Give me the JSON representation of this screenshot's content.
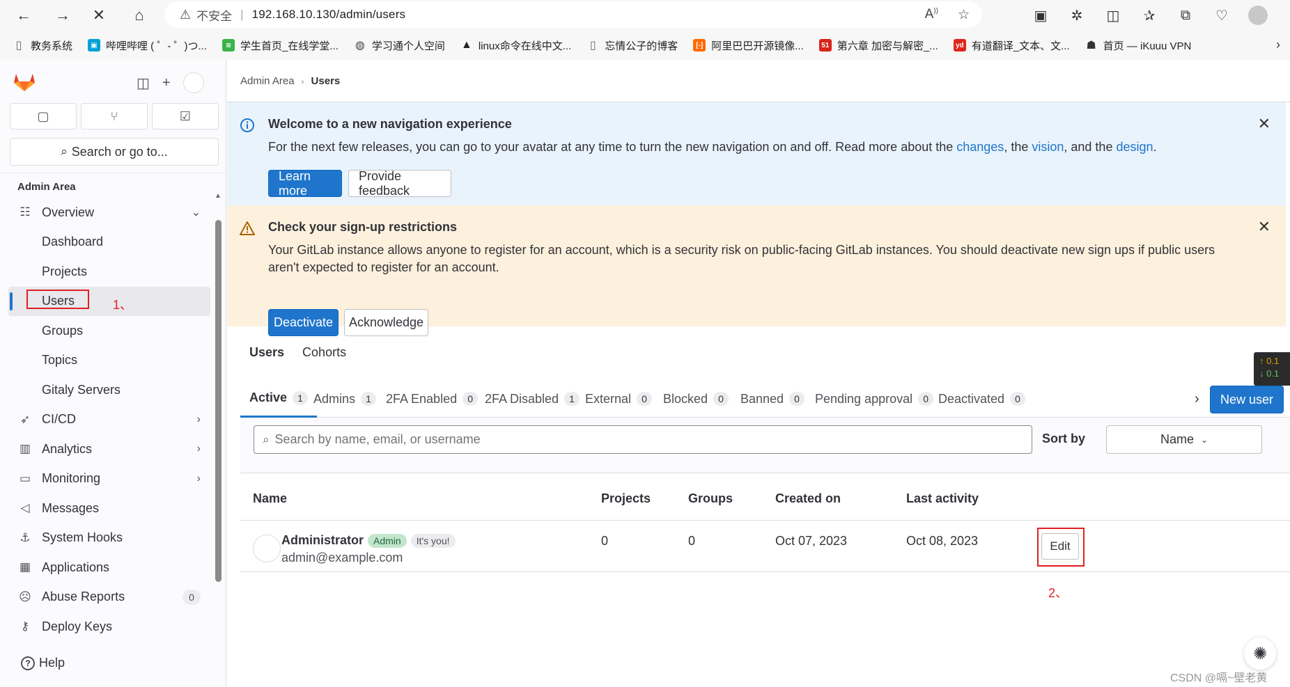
{
  "browser": {
    "insecure_label": "不安全",
    "url": "192.168.10.130/admin/users",
    "bookmarks": [
      {
        "label": "教务系统",
        "icon": "document-icon",
        "color": "#666666"
      },
      {
        "label": "哔哩哔哩 ( ゜- ゜)つ...",
        "icon": "bilibili-icon",
        "color": "#00a1d6"
      },
      {
        "label": "学生首页_在线学堂...",
        "icon": "xuetang-icon",
        "color": "#3bb34a"
      },
      {
        "label": "学习通个人空间",
        "icon": "globe-icon",
        "color": "#444444"
      },
      {
        "label": "linux命令在线中文...",
        "icon": "tux-icon",
        "color": "#222222"
      },
      {
        "label": "忘情公子的博客",
        "icon": "document-icon",
        "color": "#666666"
      },
      {
        "label": "阿里巴巴开源镜像...",
        "icon": "aliyun-icon",
        "color": "#ff6a00"
      },
      {
        "label": "第六章 加密与解密_...",
        "icon": "51cto-icon",
        "color": "#d9251c"
      },
      {
        "label": "有道翻译_文本、文...",
        "icon": "youdao-icon",
        "color": "#e1251b"
      },
      {
        "label": "首页 — iKuuu VPN",
        "icon": "ikuuu-icon",
        "color": "#333333"
      }
    ]
  },
  "sidebar": {
    "search_placeholder": "Search or go to...",
    "section_title": "Admin Area",
    "items": [
      {
        "label": "Overview",
        "icon": "overview-icon",
        "chevron": "down"
      },
      {
        "label": "Dashboard",
        "sub": true
      },
      {
        "label": "Projects",
        "sub": true
      },
      {
        "label": "Users",
        "sub": true,
        "active": true
      },
      {
        "label": "Groups",
        "sub": true
      },
      {
        "label": "Topics",
        "sub": true
      },
      {
        "label": "Gitaly Servers",
        "sub": true
      },
      {
        "label": "CI/CD",
        "icon": "rocket-icon",
        "chevron": "right"
      },
      {
        "label": "Analytics",
        "icon": "chart-icon",
        "chevron": "right"
      },
      {
        "label": "Monitoring",
        "icon": "monitor-icon",
        "chevron": "right"
      },
      {
        "label": "Messages",
        "icon": "megaphone-icon"
      },
      {
        "label": "System Hooks",
        "icon": "anchor-icon"
      },
      {
        "label": "Applications",
        "icon": "applications-icon"
      },
      {
        "label": "Abuse Reports",
        "icon": "abuse-icon",
        "count": "0"
      },
      {
        "label": "Deploy Keys",
        "icon": "key-icon"
      }
    ],
    "help_label": "Help",
    "annotation_1": "1、"
  },
  "breadcrumb": {
    "root": "Admin Area",
    "current": "Users"
  },
  "nav_alert": {
    "title": "Welcome to a new navigation experience",
    "body_pre": "For the next few releases, you can go to your avatar at any time to turn the new navigation on and off. Read more about the ",
    "link_changes": "changes",
    "body_mid1": ", the ",
    "link_vision": "vision",
    "body_mid2": ", and the ",
    "link_design": "design",
    "body_end": ".",
    "primary_button": "Learn more",
    "secondary_button": "Provide feedback"
  },
  "signup_alert": {
    "title": "Check your sign-up restrictions",
    "body": "Your GitLab instance allows anyone to register for an account, which is a security risk on public-facing GitLab instances. You should deactivate new sign ups if public users aren't expected to register for an account.",
    "primary_button": "Deactivate",
    "secondary_button": "Acknowledge"
  },
  "page_tabs": [
    "Users",
    "Cohorts"
  ],
  "filter_tabs": [
    {
      "label": "Active",
      "count": "1"
    },
    {
      "label": "Admins",
      "count": "1"
    },
    {
      "label": "2FA Enabled",
      "count": "0"
    },
    {
      "label": "2FA Disabled",
      "count": "1"
    },
    {
      "label": "External",
      "count": "0"
    },
    {
      "label": "Blocked",
      "count": "0"
    },
    {
      "label": "Banned",
      "count": "0"
    },
    {
      "label": "Pending approval",
      "count": "0"
    },
    {
      "label": "Deactivated",
      "count": "0"
    }
  ],
  "new_user_button": "New user",
  "filter": {
    "search_placeholder": "Search by name, email, or username",
    "sort_label": "Sort by",
    "sort_value": "Name"
  },
  "table": {
    "headers": {
      "name": "Name",
      "projects": "Projects",
      "groups": "Groups",
      "created": "Created on",
      "activity": "Last activity"
    },
    "rows": [
      {
        "name": "Administrator",
        "badge_admin": "Admin",
        "badge_you": "It's you!",
        "email": "admin@example.com",
        "projects": "0",
        "groups": "0",
        "created": "Oct 07, 2023",
        "activity": "Oct 08, 2023",
        "edit_label": "Edit"
      }
    ],
    "annotation_2": "2、"
  },
  "speed_widget": {
    "up": "↑ 0.1",
    "down": "↓ 0.1"
  },
  "watermark": "CSDN @嗝~壁老黄",
  "colors": {
    "accent": "#1f75cb",
    "info_bg": "#e9f3fc",
    "warning_bg": "#fdf1dd",
    "annotation_red": "#e02020"
  }
}
